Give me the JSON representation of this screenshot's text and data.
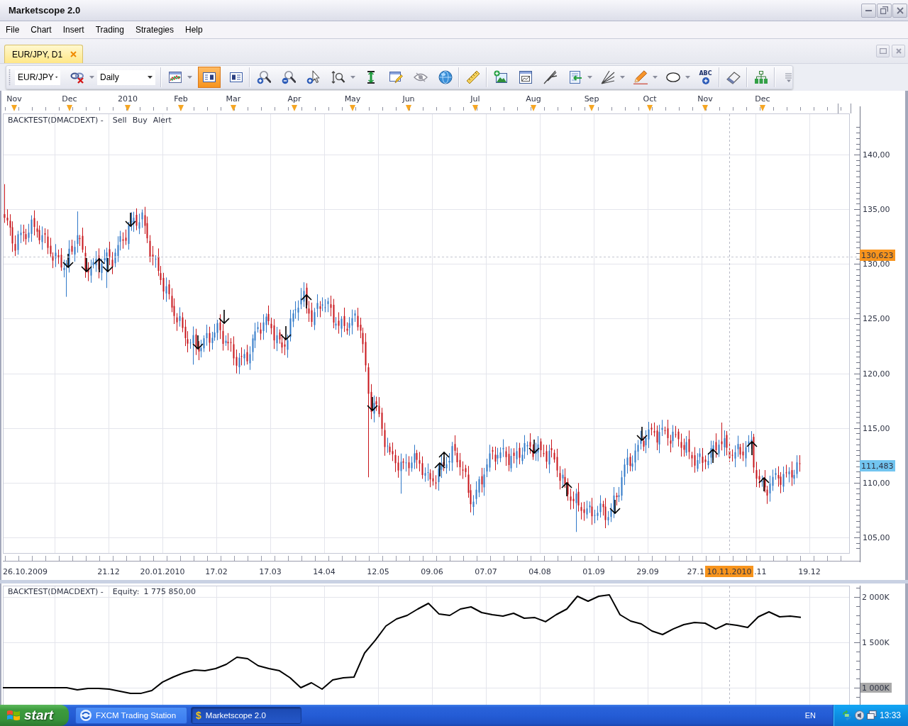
{
  "window": {
    "title": "Marketscope 2.0"
  },
  "menu": [
    "File",
    "Chart",
    "Insert",
    "Trading",
    "Strategies",
    "Help"
  ],
  "tabs": [
    {
      "label": "EUR/JPY, D1",
      "selected": true
    }
  ],
  "toolbar": [
    {
      "kind": "combo",
      "value": "EUR/JPY"
    },
    {
      "kind": "button",
      "on": false,
      "dropdown": true
    },
    {
      "kind": "combo",
      "value": "Daily"
    },
    {
      "kind": "separator"
    },
    {
      "kind": "button",
      "on": false,
      "dropdown": true
    },
    {
      "kind": "button",
      "on": true,
      "dropdown": false
    },
    {
      "kind": "button",
      "on": false,
      "dropdown": false
    },
    {
      "kind": "separator"
    },
    {
      "kind": "button",
      "on": false,
      "dropdown": false
    },
    {
      "kind": "button",
      "on": false,
      "dropdown": false
    },
    {
      "kind": "button",
      "on": false,
      "dropdown": false
    },
    {
      "kind": "button",
      "on": false,
      "dropdown": true
    },
    {
      "kind": "button",
      "on": false,
      "dropdown": false
    },
    {
      "kind": "button",
      "on": false,
      "dropdown": false
    },
    {
      "kind": "button",
      "on": false,
      "dropdown": false
    },
    {
      "kind": "button",
      "on": false,
      "dropdown": false
    },
    {
      "kind": "separator"
    },
    {
      "kind": "button",
      "on": false,
      "dropdown": false
    },
    {
      "kind": "separator"
    },
    {
      "kind": "button",
      "on": false,
      "dropdown": false
    },
    {
      "kind": "button",
      "on": false,
      "dropdown": false
    },
    {
      "kind": "button",
      "on": false,
      "dropdown": false
    },
    {
      "kind": "button",
      "on": false,
      "dropdown": true
    },
    {
      "kind": "button",
      "on": false,
      "dropdown": true
    },
    {
      "kind": "button",
      "on": false,
      "dropdown": true
    },
    {
      "kind": "button",
      "on": false,
      "dropdown": true
    },
    {
      "kind": "button",
      "on": false,
      "dropdown": false,
      "label": "ABC"
    },
    {
      "kind": "separator"
    },
    {
      "kind": "button",
      "on": false,
      "dropdown": false
    },
    {
      "kind": "separator"
    },
    {
      "kind": "button",
      "on": false,
      "dropdown": false
    },
    {
      "kind": "separator"
    },
    {
      "kind": "button",
      "on": false,
      "dropdown": false
    }
  ],
  "price_chart": {
    "months": [
      "Nov",
      "Dec",
      "2010",
      "Feb",
      "Mar",
      "Apr",
      "May",
      "Jun",
      "Jul",
      "Aug",
      "Sep",
      "Oct",
      "Nov",
      "Dec"
    ],
    "legend": {
      "title": "BACKTEST(DMACDEXT) -",
      "items": [
        "Sell",
        "Buy",
        "Alert"
      ]
    },
    "price_ticks": [
      "140,00",
      "135,00",
      "130,00",
      "125,00",
      "120,00",
      "115,00",
      "110,00",
      "105,00"
    ],
    "crosshair_price": "130,623",
    "last_price": "111,483",
    "dates": [
      "26.10.2009",
      "21.12",
      "20.01.2010",
      "17.02",
      "17.03",
      "14.04",
      "12.05",
      "09.06",
      "07.07",
      "04.08",
      "01.09",
      "29.09",
      "27.1",
      ".11",
      "19.12"
    ],
    "crosshair_date": "10.11.2010"
  },
  "equity_panel": {
    "legend": {
      "title": "BACKTEST(DMACDEXT) -",
      "value": "1 775 850,00"
    },
    "chart_data": {
      "type": "line",
      "grid": true,
      "series": [
        {
          "name": "Equity:",
          "color": "#000000",
          "values": [
            1000000,
            1000000,
            1000000,
            1000000,
            1000000,
            1000000,
            1000000,
            977000,
            992000,
            992000,
            984000,
            961000,
            938000,
            938000,
            969000,
            1062000,
            1117000,
            1164000,
            1195000,
            1187000,
            1211000,
            1258000,
            1336000,
            1320000,
            1242000,
            1211000,
            1187000,
            1109000,
            1000000,
            1055000,
            984000,
            1086000,
            1109000,
            1117000,
            1383000,
            1523000,
            1680000,
            1758000,
            1797000,
            1867000,
            1930000,
            1812000,
            1797000,
            1867000,
            1891000,
            1828000,
            1805000,
            1789000,
            1820000,
            1766000,
            1773000,
            1727000,
            1805000,
            1867000,
            2008000,
            1953000,
            2008000,
            2023000,
            1805000,
            1734000,
            1703000,
            1625000,
            1586000,
            1648000,
            1695000,
            1719000,
            1711000,
            1648000,
            1703000,
            1688000,
            1664000,
            1781000,
            1836000,
            1781000,
            1789000,
            1776000
          ]
        }
      ],
      "ylim": [
        812500,
        2125000
      ],
      "yticks": [
        {
          "value": 2000000,
          "label": "2 000K"
        },
        {
          "value": 1500000,
          "label": "1 500K"
        },
        {
          "value": 1000000,
          "label": "1 000K"
        }
      ]
    }
  },
  "taskbar": {
    "start": "start",
    "tasks": [
      {
        "label": "FXCM Trading Station",
        "selected": false
      },
      {
        "label": "Marketscope 2.0",
        "icon": "$",
        "selected": true
      }
    ],
    "language": "EN",
    "clock": "13:33"
  }
}
